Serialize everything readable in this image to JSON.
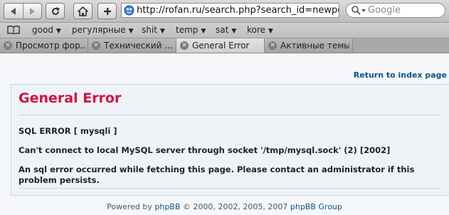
{
  "toolbar": {
    "url": "http://rofan.ru/search.php?search_id=newposts",
    "search_placeholder": "Google"
  },
  "bookmarks": [
    {
      "label": "good"
    },
    {
      "label": "регулярные"
    },
    {
      "label": "shit"
    },
    {
      "label": "temp"
    },
    {
      "label": "sat"
    },
    {
      "label": "kore"
    }
  ],
  "tabs": [
    {
      "label": "Просмотр фор...",
      "active": false
    },
    {
      "label": "Технический ...",
      "active": false
    },
    {
      "label": "General Error",
      "active": true
    },
    {
      "label": "Активные темы",
      "active": false
    }
  ],
  "page": {
    "return_link": "Return to index page",
    "title": "General Error",
    "error_type": "SQL ERROR [ mysqli ]",
    "error_message": "Can't connect to local MySQL server through socket '/tmp/mysql.sock' (2) [2002]",
    "description": "An sql error occurred while fetching this page. Please contact an administrator if this problem persists."
  },
  "footer": {
    "prefix": "Powered by ",
    "brand": "phpBB",
    "years": " © 2000, 2002, 2005, 2007 ",
    "group": "phpBB Group"
  },
  "colors": {
    "error_title": "#d31141",
    "link": "#105289"
  }
}
